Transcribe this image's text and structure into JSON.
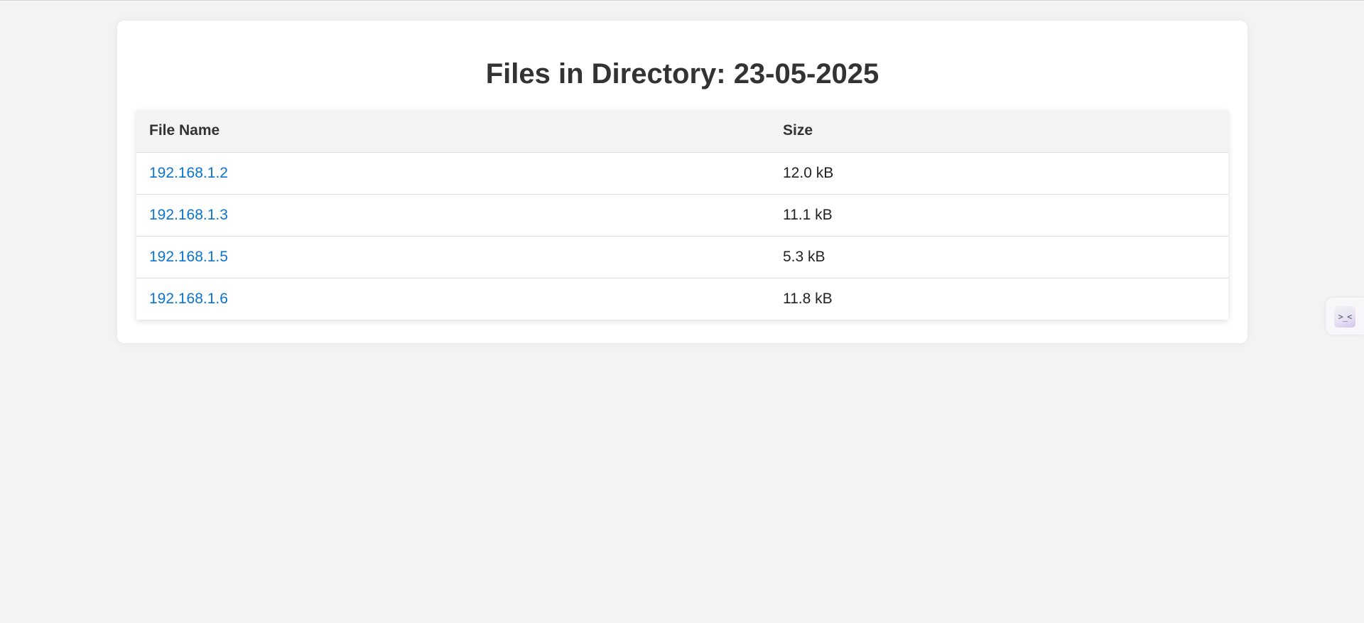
{
  "page": {
    "title": "Files in Directory: 23-05-2025"
  },
  "table": {
    "headers": {
      "name": "File Name",
      "size": "Size"
    },
    "rows": [
      {
        "name": "192.168.1.2",
        "size": "12.0 kB"
      },
      {
        "name": "192.168.1.3",
        "size": "11.1 kB"
      },
      {
        "name": "192.168.1.5",
        "size": "5.3 kB"
      },
      {
        "name": "192.168.1.6",
        "size": "11.8 kB"
      }
    ]
  },
  "side_widget": {
    "icon": "face-icon",
    "glyph": ">_<"
  },
  "colors": {
    "background": "#f3f3f3",
    "link": "#0a74d1",
    "title": "#333333"
  }
}
